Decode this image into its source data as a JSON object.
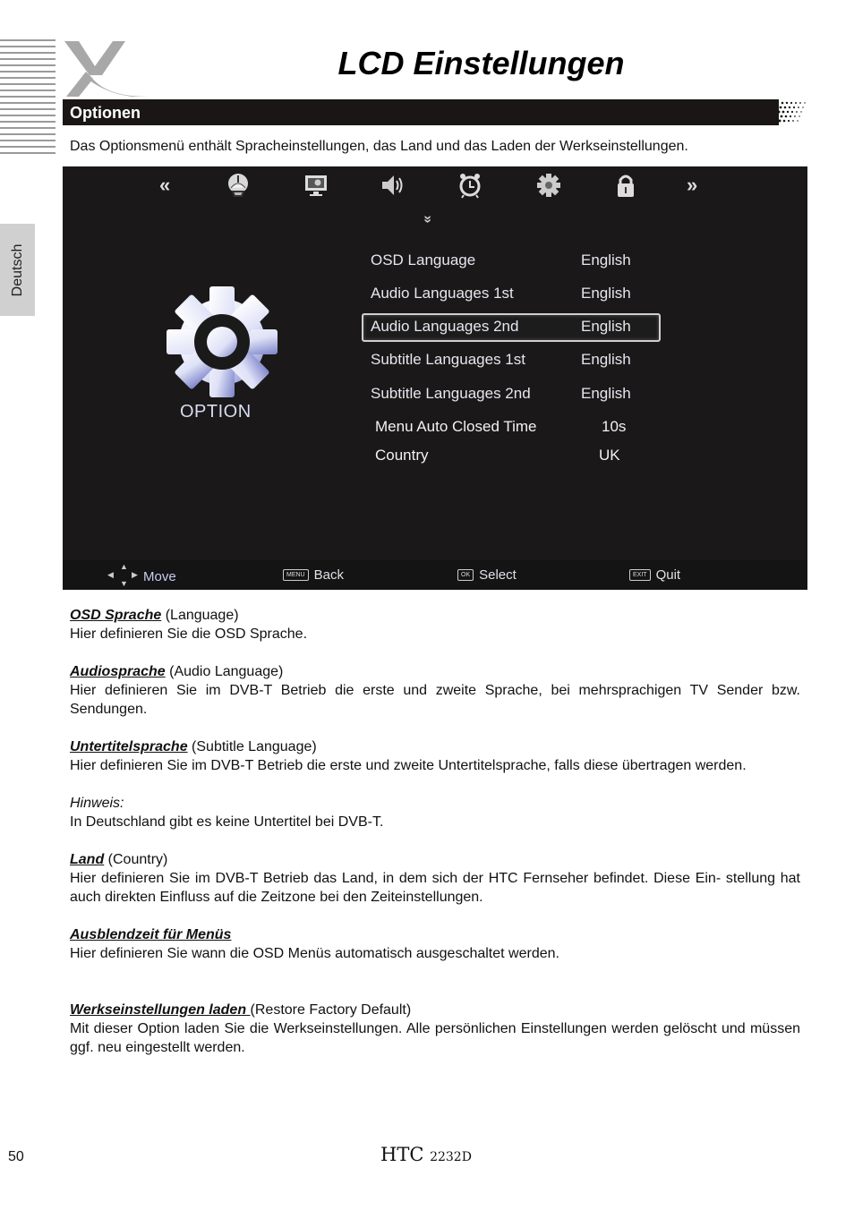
{
  "page": {
    "title": "LCD Einstellungen",
    "section": "Optionen",
    "intro": "Das Optionsmenü enthält Spracheinstellungen, das Land und das Laden der Werkseinstellungen.",
    "language_tab": "Deutsch",
    "page_number": "50",
    "model_prefix": "HTC ",
    "model_number": "2232D"
  },
  "osd": {
    "top_icons": [
      {
        "name": "prev-arrow",
        "glyph": "«"
      },
      {
        "name": "channel-icon"
      },
      {
        "name": "picture-icon"
      },
      {
        "name": "sound-icon"
      },
      {
        "name": "timer-icon"
      },
      {
        "name": "option-icon"
      },
      {
        "name": "lock-icon"
      },
      {
        "name": "next-arrow",
        "glyph": "»"
      }
    ],
    "down_glyph": "»",
    "option_label": "OPTION",
    "rows": [
      {
        "label": "OSD Language",
        "value": "English"
      },
      {
        "label": "Audio Languages 1st",
        "value": "English"
      },
      {
        "label": "Audio Languages 2nd",
        "value": "English",
        "selected": true
      },
      {
        "label": "Subtitle Languages 1st",
        "value": "English"
      },
      {
        "label": "Subtitle Languages 2nd",
        "value": "English"
      },
      {
        "label": "Menu Auto Closed Time",
        "value": "10s"
      },
      {
        "label": "Country",
        "value": "UK"
      }
    ],
    "footer": {
      "move": "Move",
      "back_key": "MENU",
      "back": "Back",
      "select_key": "OK",
      "select": "Select",
      "quit_key": "EXIT",
      "quit": "Quit"
    }
  },
  "sections": [
    {
      "heading": "OSD Sprache",
      "suffix": " (Language)",
      "text": "Hier definieren Sie die OSD Sprache."
    },
    {
      "heading": "Audiosprache",
      "suffix": " (Audio Language)",
      "text": "Hier definieren Sie im DVB-T Betrieb die erste und zweite Sprache, bei mehrsprachigen TV Sender bzw. Sendungen."
    },
    {
      "heading": "Untertitelsprache",
      "suffix": " (Subtitle Language)",
      "text": "Hier definieren Sie im DVB-T Betrieb die erste und zweite Untertitelsprache, falls diese übertragen werden."
    },
    {
      "note_label": "Hinweis:",
      "text": "In Deutschland gibt es keine Untertitel bei DVB-T."
    },
    {
      "heading": "Land",
      "suffix": " (Country)",
      "text": "Hier definieren Sie im DVB-T Betrieb das Land, in dem sich der HTC Fernseher befindet. Diese Ein- stellung hat auch direkten Einfluss auf die Zeitzone bei den Zeiteinstellungen."
    },
    {
      "heading": "Ausblendzeit für Menüs",
      "suffix": "",
      "text": "Hier definieren Sie wann die OSD Menüs automatisch ausgeschaltet werden."
    },
    {
      "heading": "Werkseinstellungen laden ",
      "suffix": "(Restore Factory Default)",
      "text": "Mit dieser Option laden Sie die Werkseinstellungen. Alle persönlichen Einstellungen werden gelöscht und müssen ggf. neu eingestellt werden."
    }
  ]
}
